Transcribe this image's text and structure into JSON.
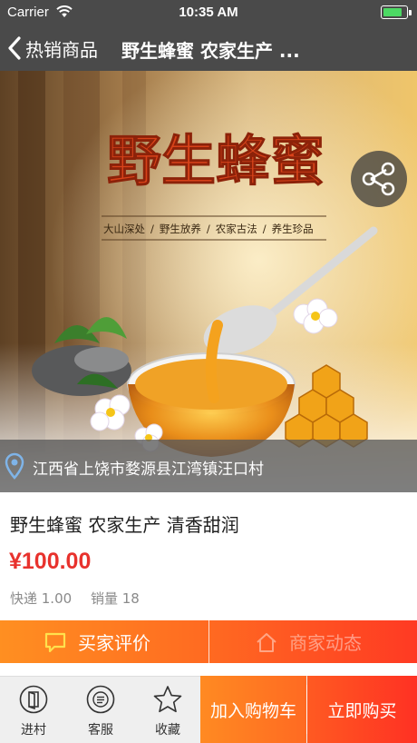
{
  "status": {
    "carrier": "Carrier",
    "time": "10:35 AM",
    "battery_level": 0.85
  },
  "nav": {
    "back_label": "热销商品",
    "title": "野生蜂蜜 农家生产 ..."
  },
  "hero": {
    "headline": "野生蜂蜜",
    "tags": [
      "大山深处",
      "/",
      "野生放养",
      "/",
      "农家古法",
      "/",
      "养生珍品"
    ],
    "location": "江西省上饶市婺源县江湾镇汪口村"
  },
  "product": {
    "name": "野生蜂蜜 农家生产 清香甜润",
    "price": "¥100.00",
    "shipping": "快递 1.00",
    "sales": "销量 18"
  },
  "tabs": {
    "review": "买家评价",
    "news": "商家动态"
  },
  "bottom": {
    "store": "进村",
    "service": "客服",
    "favorite": "收藏",
    "add_to_cart": "加入购物车",
    "buy_now": "立即购买"
  },
  "colors": {
    "accent": "#ff6a21",
    "price": "#e8322d",
    "nav": "#4a4a4a"
  }
}
